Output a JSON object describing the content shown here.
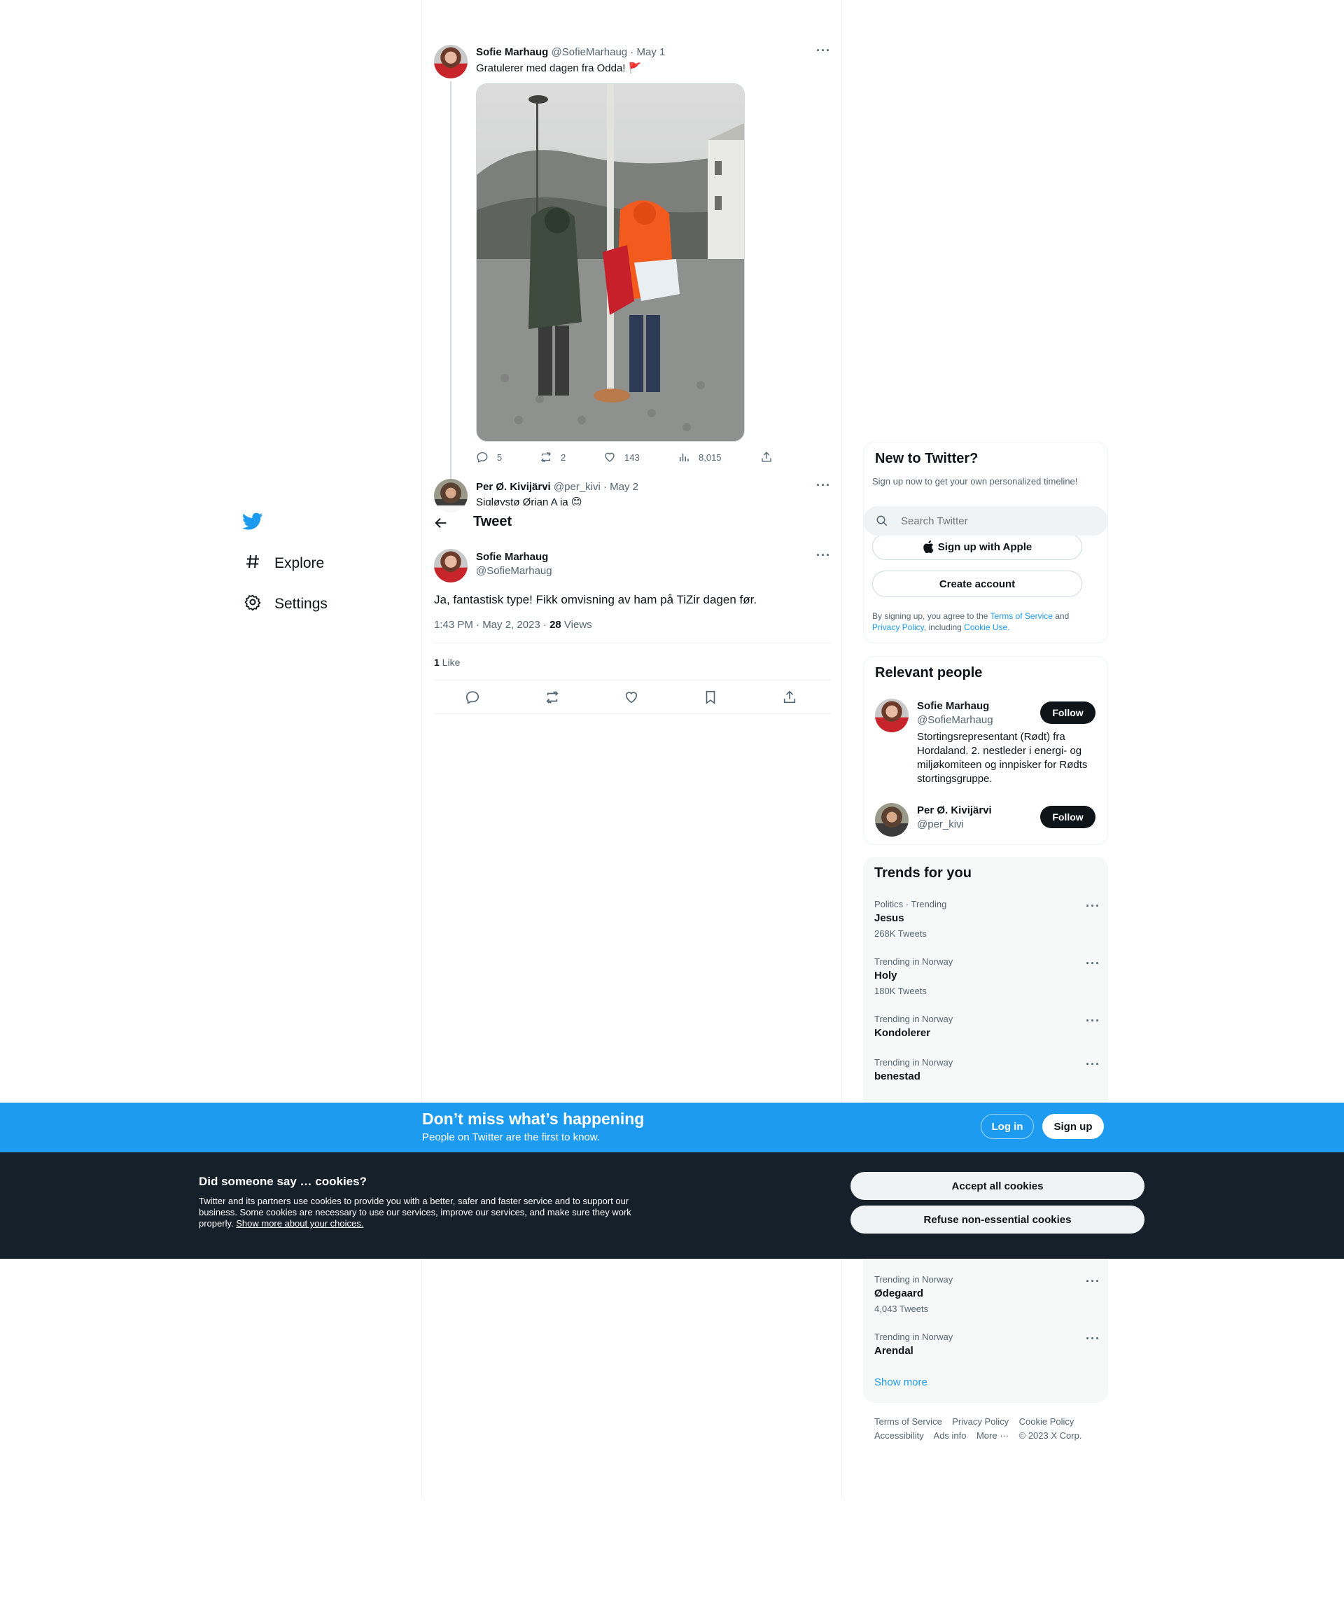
{
  "nav": {
    "items": [
      {
        "label": "Explore",
        "icon": "hashtag-icon"
      },
      {
        "label": "Settings",
        "icon": "gear-icon"
      }
    ]
  },
  "thread": {
    "parent": {
      "name": "Sofie Marhaug",
      "handle": "@SofieMarhaug",
      "date": "· May 1",
      "text": "Gratulerer med dagen fra Odda! 🚩",
      "replies": "5",
      "retweets": "2",
      "likes": "143",
      "views": "8,015"
    },
    "second": {
      "name": "Per Ø. Kivijärvi",
      "handle": "@per_kivi",
      "date": "· May 2",
      "text": "Sigløystø Ørjan A ja 😊"
    }
  },
  "header": {
    "title": "Tweet"
  },
  "main_tweet": {
    "name": "Sofie Marhaug",
    "handle": "@SofieMarhaug",
    "text": "Ja, fantastisk type! Fikk omvisning av ham på TiZir dagen før.",
    "timestamp": "1:43 PM · May 2, 2023 · ",
    "views_count": "28",
    "views_label": " Views",
    "likes_count": "1",
    "likes_label": " Like"
  },
  "search": {
    "placeholder": "Search Twitter"
  },
  "signup_panel": {
    "title": "New to Twitter?",
    "subtitle": "Sign up now to get your own personalized timeline!",
    "apple_label": "Sign up with Apple",
    "create_label": "Create account",
    "terms_prefix": "By signing up, you agree to the ",
    "terms_link": "Terms of Service",
    "terms_and": " and",
    "privacy_link": "Privacy Policy",
    "including": ", including ",
    "cookie_link": "Cookie Use."
  },
  "relevant_people": {
    "title": "Relevant people",
    "people": [
      {
        "name": "Sofie Marhaug",
        "handle": "@SofieMarhaug",
        "bio": "Stortingsrepresentant (Rødt) fra Hordaland. 2. nestleder i energi- og miljøkomiteen og innpisker for Rødts stortingsgruppe.",
        "follow": "Follow"
      },
      {
        "name": "Per Ø. Kivijärvi",
        "handle": "@per_kivi",
        "bio": "",
        "follow": "Follow"
      }
    ]
  },
  "trends": {
    "title": "Trends for you",
    "items": [
      {
        "category": "Politics · Trending",
        "name": "Jesus",
        "count": "268K Tweets"
      },
      {
        "category": "Trending in Norway",
        "name": "Holy",
        "count": "180K Tweets"
      },
      {
        "category": "Trending in Norway",
        "name": "Kondolerer",
        "count": ""
      },
      {
        "category": "Trending in Norway",
        "name": "benestad",
        "count": ""
      },
      {
        "category": "Trending in Norway",
        "name": "Ødegaard",
        "count": "4,043 Tweets"
      },
      {
        "category": "Trending in Norway",
        "name": "Arendal",
        "count": ""
      }
    ],
    "show_more": "Show more"
  },
  "footer": {
    "links_row1": [
      "Terms of Service",
      "Privacy Policy",
      "Cookie Policy"
    ],
    "links_row2": [
      "Accessibility",
      "Ads info",
      "More ···",
      "© 2023 X Corp."
    ]
  },
  "banner": {
    "title": "Don’t miss what’s happening",
    "subtitle": "People on Twitter are the first to know.",
    "login": "Log in",
    "signup": "Sign up"
  },
  "cookies": {
    "title": "Did someone say … cookies?",
    "body": "Twitter and its partners use cookies to provide you with a better, safer and faster service and to support our business. Some cookies are necessary to use our services, improve our services, and make sure they work properly. ",
    "link": "Show more about your choices.",
    "accept": "Accept all cookies",
    "refuse": "Refuse non-essential cookies"
  },
  "colors": {
    "accent": "#1d9bf0",
    "dark": "#15202b",
    "text": "#0f1419",
    "muted": "#536471"
  }
}
